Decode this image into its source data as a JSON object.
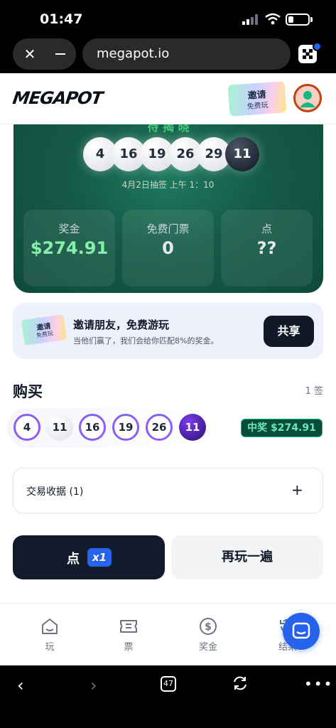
{
  "status_bar": {
    "time": "01:47"
  },
  "browser": {
    "url": "megapot.io",
    "close": "✕",
    "tab_count": "47"
  },
  "header": {
    "logo": "MEGAPOT",
    "invite_line1": "邀请",
    "invite_line2": "免费玩"
  },
  "draw_card": {
    "title": "待 揭 晓",
    "balls": [
      "4",
      "16",
      "19",
      "26",
      "29",
      "11"
    ],
    "draw_time": "4月2日抽签 上午 1：10",
    "stats": [
      {
        "label": "奖金",
        "value": "$274.91"
      },
      {
        "label": "免费门票",
        "value": "0"
      },
      {
        "label": "点",
        "value": "??"
      }
    ]
  },
  "invite_banner": {
    "ticket_line1": "邀请",
    "ticket_line2": "免费玩",
    "title": "邀请朋友，免费游玩",
    "subtitle": "当他们赢了，我们会给你匹配8%的奖金。",
    "share": "共享"
  },
  "buy": {
    "title": "购买",
    "count": "1 签",
    "picks": [
      "4",
      "11",
      "16",
      "19",
      "26",
      "11"
    ],
    "win_badge": "中奖 $274.91"
  },
  "receipt": {
    "label": "交易收据 (1)",
    "expand": "+"
  },
  "actions": {
    "play": "点",
    "multiplier": "x1",
    "replay": "再玩一遍"
  },
  "bottom_nav": [
    {
      "label": "玩",
      "icon": "home-icon"
    },
    {
      "label": "票",
      "icon": "ticket-icon"
    },
    {
      "label": "奖金",
      "icon": "dollar-icon"
    },
    {
      "label": "结果",
      "icon": "history-icon"
    }
  ],
  "colors": {
    "accent": "#2563eb",
    "card_green": "#145a46",
    "win_green": "#6ee7b7",
    "pick_purple": "#8b5cf6",
    "dark_button": "#121a2c"
  }
}
